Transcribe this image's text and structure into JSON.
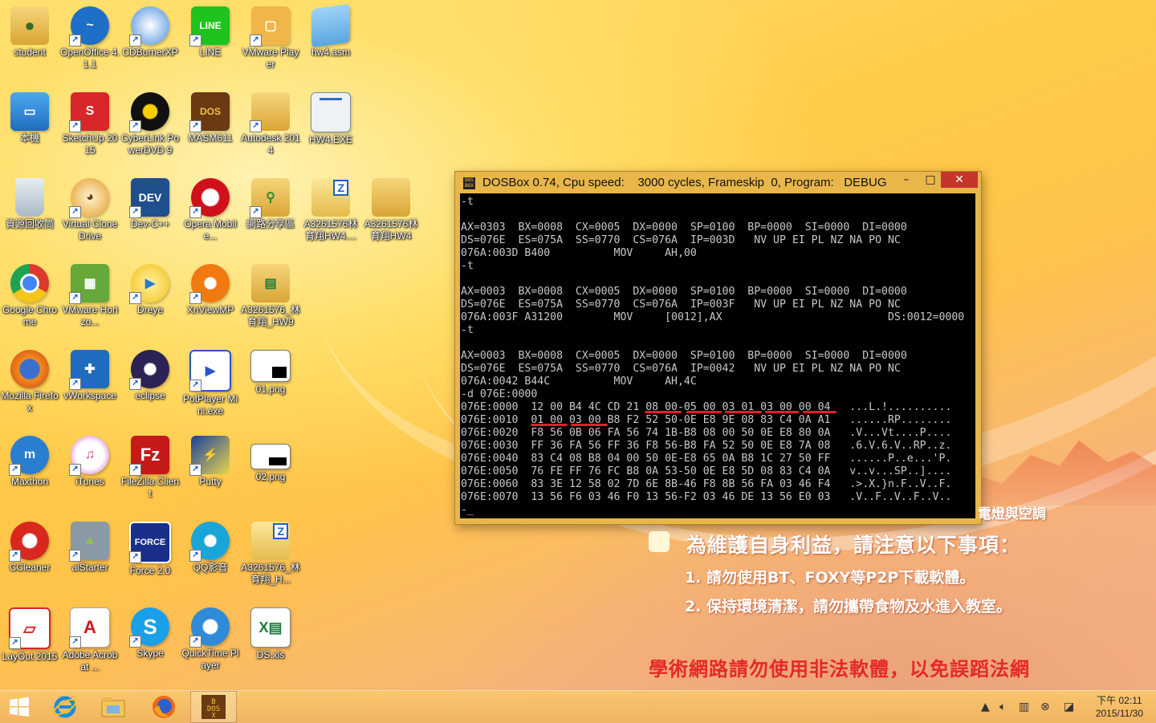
{
  "desktop_icons": [
    {
      "label": "student",
      "icon": "user-folder-icon"
    },
    {
      "label": "OpenOffice 4.1.1",
      "icon": "openoffice-icon"
    },
    {
      "label": "CDBurnerXP",
      "icon": "cdburner-icon"
    },
    {
      "label": "LINE",
      "icon": "line-icon"
    },
    {
      "label": "VMware Player",
      "icon": "vmware-player-icon"
    },
    {
      "label": "hw4.asm",
      "icon": "notepad-file-icon"
    },
    {
      "label": "本機",
      "icon": "computer-icon"
    },
    {
      "label": "SketchUp 2015",
      "icon": "sketchup-icon"
    },
    {
      "label": "CyberLink PowerDVD 9",
      "icon": "powerdvd-icon"
    },
    {
      "label": "MASM611",
      "icon": "dosbox-icon"
    },
    {
      "label": "Autodesk 2014",
      "icon": "folder-icon"
    },
    {
      "label": "HW4.EXE",
      "icon": "exe-file-icon"
    },
    {
      "label": "資源回收筒",
      "icon": "recycle-bin-icon"
    },
    {
      "label": "Virtual CloneDrive",
      "icon": "clonedrive-icon"
    },
    {
      "label": "Dev-C++",
      "icon": "devcpp-icon"
    },
    {
      "label": "Opera Mobile...",
      "icon": "opera-icon"
    },
    {
      "label": "網路分享區",
      "icon": "network-folder-icon"
    },
    {
      "label": "A3261576林育翔HW4....",
      "icon": "zip-folder-icon"
    },
    {
      "label": "A3261576林育翔HW4",
      "icon": "folder-icon"
    },
    {
      "label": "Google Chrome",
      "icon": "chrome-icon"
    },
    {
      "label": "VMware Horizo...",
      "icon": "vmware-horizon-icon"
    },
    {
      "label": "Dreye",
      "icon": "dreye-icon"
    },
    {
      "label": "XnViewMP",
      "icon": "xnview-icon"
    },
    {
      "label": "A3261576_林育翔_HW9",
      "icon": "excel-folder-icon"
    },
    {
      "label": "Mozilla Firefox",
      "icon": "firefox-icon"
    },
    {
      "label": "vWorkspace",
      "icon": "vworkspace-icon"
    },
    {
      "label": "eclipse",
      "icon": "eclipse-icon"
    },
    {
      "label": "PotPlayer Mini.exe",
      "icon": "potplayer-icon"
    },
    {
      "label": "01.png",
      "icon": "image-file-icon"
    },
    {
      "label": "Maxthon",
      "icon": "maxthon-icon"
    },
    {
      "label": "iTunes",
      "icon": "itunes-icon"
    },
    {
      "label": "FileZilla Client",
      "icon": "filezilla-icon"
    },
    {
      "label": "Putty",
      "icon": "putty-icon"
    },
    {
      "label": "02.png",
      "icon": "image-file-icon"
    },
    {
      "label": "CCleaner",
      "icon": "ccleaner-icon"
    },
    {
      "label": "aiStarter",
      "icon": "aistarter-icon"
    },
    {
      "label": "Force 2.0",
      "icon": "force-icon"
    },
    {
      "label": "QQ影音",
      "icon": "qqplayer-icon"
    },
    {
      "label": "A3261576_林育翔_H...",
      "icon": "zip-folder-icon"
    },
    {
      "label": "LayOut 2015",
      "icon": "layout-icon"
    },
    {
      "label": "Adobe Acrobat ...",
      "icon": "acrobat-icon"
    },
    {
      "label": "Skype",
      "icon": "skype-icon"
    },
    {
      "label": "QuickTime Player",
      "icon": "quicktime-icon"
    },
    {
      "label": "DS.xls",
      "icon": "excel-file-icon"
    }
  ],
  "dosbox": {
    "title": "DOSBox 0.74, Cpu speed:    3000 cycles, Frameskip  0, Program:   DEBUG",
    "minimize": "–",
    "maximize": "□",
    "close": "✕",
    "console": "-t\n\nAX=0303  BX=0008  CX=0005  DX=0000  SP=0100  BP=0000  SI=0000  DI=0000\nDS=076E  ES=075A  SS=0770  CS=076A  IP=003D   NV UP EI PL NZ NA PO NC\n076A:003D B400          MOV     AH,00\n-t\n\nAX=0003  BX=0008  CX=0005  DX=0000  SP=0100  BP=0000  SI=0000  DI=0000\nDS=076E  ES=075A  SS=0770  CS=076A  IP=003F   NV UP EI PL NZ NA PO NC\n076A:003F A31200        MOV     [0012],AX                          DS:0012=0000\n-t\n\nAX=0003  BX=0008  CX=0005  DX=0000  SP=0100  BP=0000  SI=0000  DI=0000\nDS=076E  ES=075A  SS=0770  CS=076A  IP=0042   NV UP EI PL NZ NA PO NC\n076A:0042 B44C          MOV     AH,4C\n-d 076E:0000\n076E:0000  12 00 B4 4C CD 21 08 00-05 00 03 01 03 00 00 04   ...L.!..........\n076E:0010  01 00 03 00 B8 F2 52 50-0E E8 9E 08 83 C4 0A A1   ......RP........\n076E:0020  F8 56 0B 06 FA 56 74 1B-B8 08 00 50 0E E8 80 0A   .V...Vt....P....\n076E:0030  FF 36 FA 56 FF 36 F8 56-B8 FA 52 50 0E E8 7A 08   .6.V.6.V..RP..z.\n076E:0040  83 C4 08 B8 04 00 50 0E-E8 65 0A B8 1C 27 50 FF   ......P..e...'P.\n076E:0050  76 FE FF 76 FC B8 0A 53-50 0E E8 5D 08 83 C4 0A   v..v...SP..].... \n076E:0060  83 3E 12 58 02 7D 6E 8B-46 F8 8B 56 FA 03 46 F4   .>.X.}n.F..V..F.\n076E:0070  13 56 F6 03 46 F0 13 56-F2 03 46 DE 13 56 E0 03   .V..F..V..F..V..\n-_"
  },
  "notice": {
    "tail": "電燈與空調",
    "heading": "為維護自身利益，請注意以下事項：",
    "items": [
      "1. 請勿使用BT、FOXY等P2P下載軟體。",
      "2. 保持環境清潔，請勿攜帶食物及水進入教室。"
    ],
    "warning": "學術網路請勿使用非法軟體，以免誤蹈法網"
  },
  "taskbar": {
    "items": [
      "start-icon",
      "internet-explorer-icon",
      "file-explorer-icon",
      "firefox-icon",
      "dosbox-icon"
    ],
    "clock_time": "下午 02:11",
    "clock_date": "2015/11/30"
  },
  "colors": {
    "warning": "#e62828",
    "close_button": "#c7342b",
    "underline": "#e0202a"
  }
}
